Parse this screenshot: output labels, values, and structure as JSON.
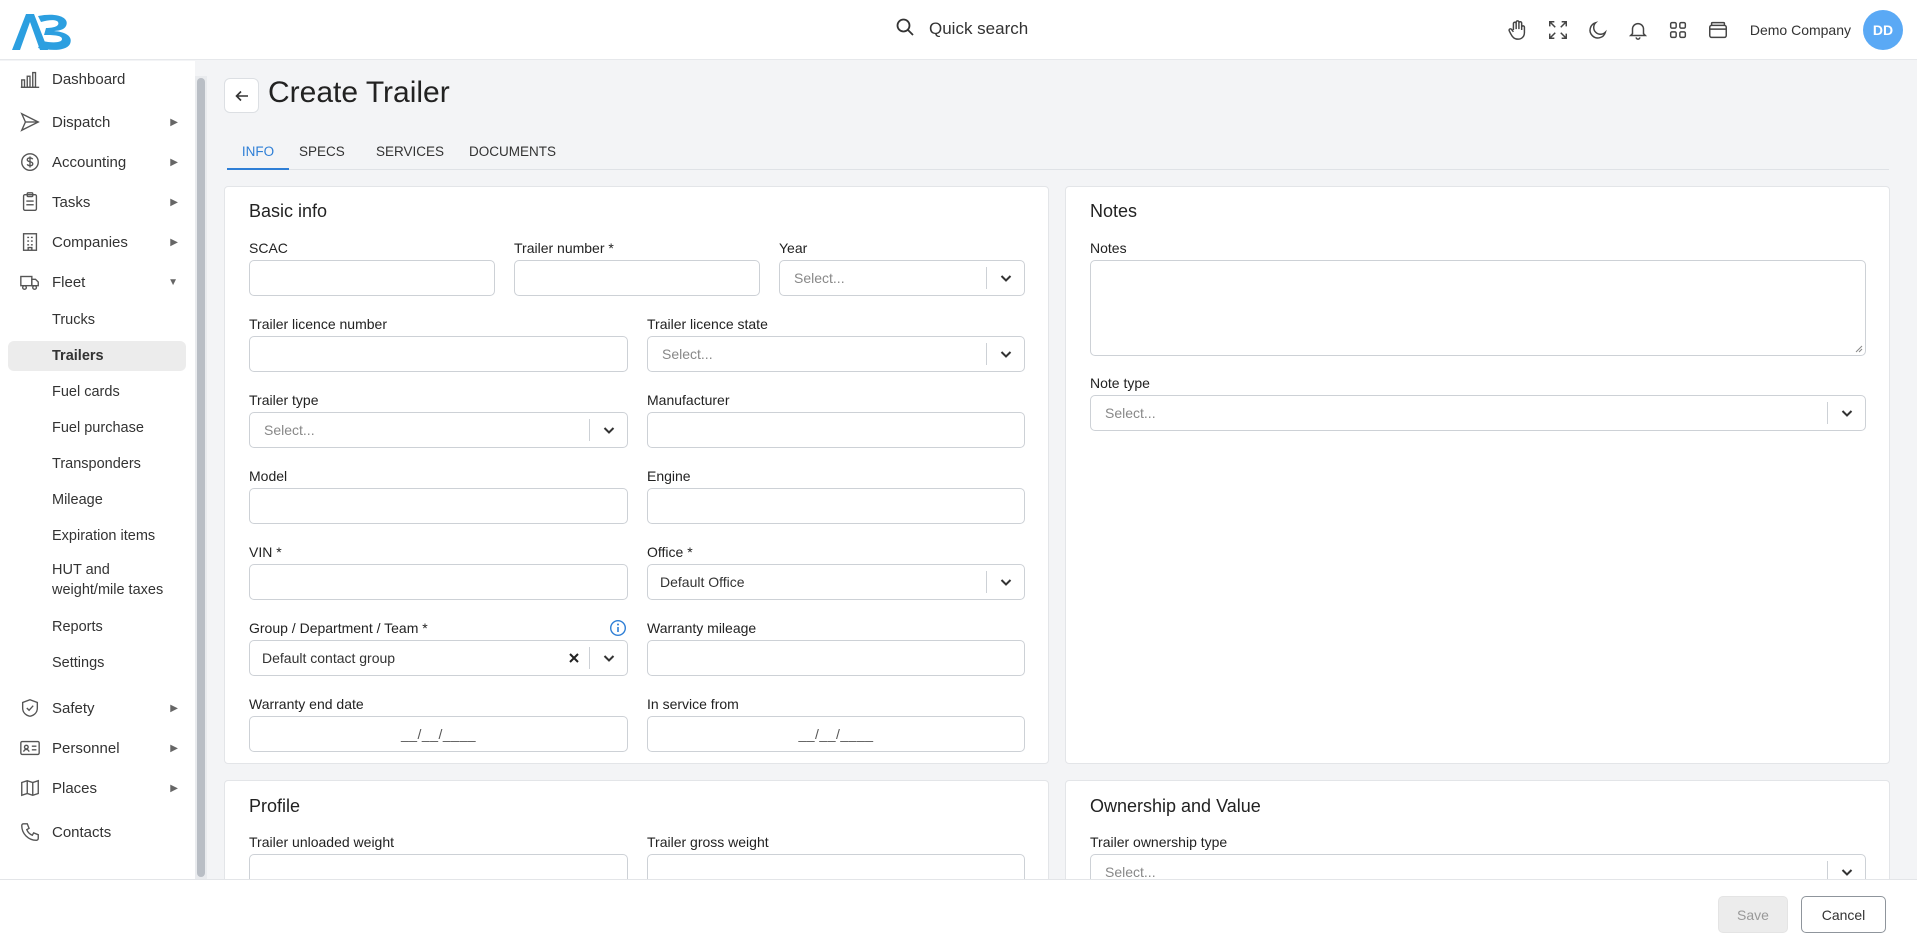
{
  "header": {
    "logo_text": "AB",
    "quick_search": "Quick search",
    "company": "Demo Company",
    "avatar": "DD"
  },
  "sidebar": {
    "items": [
      {
        "label": "Dashboard"
      },
      {
        "label": "Dispatch"
      },
      {
        "label": "Accounting"
      },
      {
        "label": "Tasks"
      },
      {
        "label": "Companies"
      },
      {
        "label": "Fleet"
      },
      {
        "label": "Safety"
      },
      {
        "label": "Personnel"
      },
      {
        "label": "Places"
      },
      {
        "label": "Contacts"
      }
    ],
    "fleet_sub": [
      {
        "label": "Trucks"
      },
      {
        "label": "Trailers"
      },
      {
        "label": "Fuel cards"
      },
      {
        "label": "Fuel purchase"
      },
      {
        "label": "Transponders"
      },
      {
        "label": "Mileage"
      },
      {
        "label": "Expiration items"
      },
      {
        "label": "HUT and weight/mile taxes"
      },
      {
        "label": "Reports"
      },
      {
        "label": "Settings"
      }
    ]
  },
  "page": {
    "title": "Create Trailer",
    "tabs": [
      {
        "label": "INFO"
      },
      {
        "label": "SPECS"
      },
      {
        "label": "SERVICES"
      },
      {
        "label": "DOCUMENTS"
      }
    ]
  },
  "basic_info": {
    "title": "Basic info",
    "scac": "SCAC",
    "trailer_number": "Trailer number *",
    "year": "Year",
    "year_placeholder": "Select...",
    "licence_number": "Trailer licence number",
    "licence_state": "Trailer licence state",
    "licence_state_placeholder": "Select...",
    "trailer_type": "Trailer type",
    "trailer_type_placeholder": "Select...",
    "manufacturer": "Manufacturer",
    "model": "Model",
    "engine": "Engine",
    "vin": "VIN *",
    "office": "Office *",
    "office_value": "Default Office",
    "group": "Group / Department / Team *",
    "group_value": "Default contact group",
    "warranty_mileage": "Warranty mileage",
    "warranty_end": "Warranty end date",
    "warranty_end_mask": "__/__/____",
    "in_service": "In service from",
    "in_service_mask": "__/__/____"
  },
  "notes": {
    "title": "Notes",
    "notes_label": "Notes",
    "note_type": "Note type",
    "note_type_placeholder": "Select..."
  },
  "profile": {
    "title": "Profile",
    "unloaded_weight": "Trailer unloaded weight",
    "gross_weight": "Trailer gross weight"
  },
  "ownership": {
    "title": "Ownership and Value",
    "ownership_type": "Trailer ownership type",
    "ownership_placeholder": "Select..."
  },
  "footer": {
    "save": "Save",
    "cancel": "Cancel"
  }
}
